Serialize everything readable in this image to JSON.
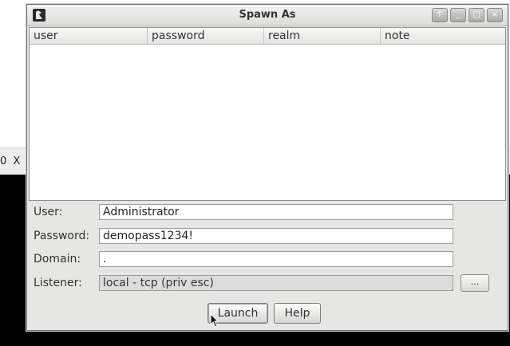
{
  "background": {
    "strip_text": "0 X"
  },
  "window": {
    "title": "Spawn As",
    "icons": [
      "app-icon",
      "shade-icon",
      "minimize-icon",
      "maximize-icon",
      "close-icon"
    ],
    "buttons": {
      "shade": "↑",
      "minimize": "_",
      "maximize": "□",
      "close": "×"
    }
  },
  "table": {
    "columns": [
      "user",
      "password",
      "realm",
      "note"
    ],
    "rows": []
  },
  "form": {
    "user_label": "User:",
    "user_value": "Administrator",
    "password_label": "Password:",
    "password_value": "demopass1234!",
    "domain_label": "Domain:",
    "domain_value": ".",
    "listener_label": "Listener:",
    "listener_value": "local - tcp (priv esc)",
    "browse_label": "..."
  },
  "actions": {
    "launch_label": "Launch",
    "help_label": "Help"
  },
  "colors": {
    "window_bg": "#e6e6e4",
    "field_bg": "#ffffff",
    "disabled_field_bg": "#dcdcdc"
  }
}
